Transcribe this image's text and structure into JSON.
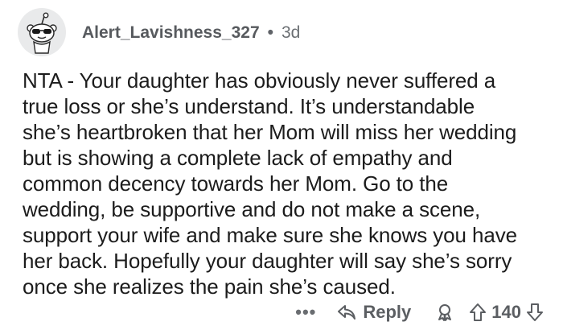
{
  "comment": {
    "username": "Alert_Lavishness_327",
    "separator": "•",
    "age": "3d",
    "body": "NTA - Your daughter has obviously never suffered a\ntrue loss or she’s understand. It’s understandable\nshe’s heartbroken that her Mom will miss her wedding\nbut is showing a complete lack of empathy and\ncommon decency towards her Mom. Go to the\nwedding, be supportive and do not make a scene,\nsupport your wife and make sure she knows you have\nher back. Hopefully your daughter will say she’s sorry\nonce she realizes the pain she’s caused.",
    "actions": {
      "more": "•••",
      "reply_label": "Reply",
      "vote_count": "140"
    },
    "icons": {
      "avatar": "snoo-avatar-icon",
      "reply": "reply-arrow-icon",
      "award": "award-icon",
      "upvote": "upvote-icon",
      "downvote": "downvote-icon"
    }
  }
}
